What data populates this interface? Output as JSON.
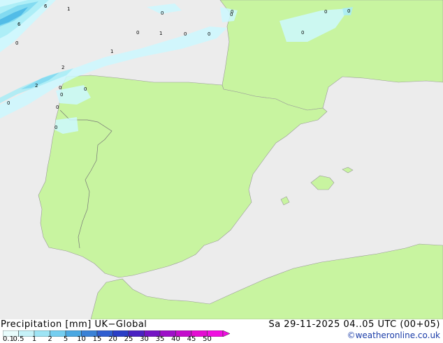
{
  "map": {
    "land_color": "#c8f4a0",
    "sea_color": "#ececec",
    "precip_colors": [
      "#cdf8ff",
      "#a8ecf6",
      "#7ed8f0",
      "#4cb8e6"
    ],
    "labels": [
      {
        "text": "6"
      },
      {
        "text": "1"
      },
      {
        "text": "6"
      },
      {
        "text": "0"
      },
      {
        "text": "0"
      },
      {
        "text": "2"
      },
      {
        "text": "2"
      },
      {
        "text": "0"
      },
      {
        "text": "0"
      },
      {
        "text": "0"
      },
      {
        "text": "0"
      },
      {
        "text": "0"
      },
      {
        "text": "1"
      },
      {
        "text": "0"
      },
      {
        "text": "0"
      },
      {
        "text": "1"
      },
      {
        "text": "0"
      },
      {
        "text": "0"
      },
      {
        "text": "0"
      },
      {
        "text": "0"
      },
      {
        "text": "0"
      },
      {
        "text": "0"
      },
      {
        "text": "0"
      }
    ]
  },
  "footer": {
    "title_left": "Precipitation [mm] UK−Global",
    "title_right": "Sa 29-11-2025 04..05 UTC (00+05)",
    "credit": "©weatheronline.co.uk",
    "legend": {
      "ticks": [
        "0.1",
        "0.5",
        "1",
        "2",
        "5",
        "10",
        "15",
        "20",
        "25",
        "30",
        "35",
        "40",
        "45",
        "50"
      ],
      "colors": [
        "#e8fcfc",
        "#c6f2f8",
        "#9ee4f4",
        "#74cef0",
        "#4aa8e2",
        "#3a82d6",
        "#2f5ed0",
        "#2a3ec6",
        "#4a22c2",
        "#7414c4",
        "#9e10c8",
        "#c40ccc",
        "#e40cd2",
        "#f010e0"
      ]
    }
  }
}
